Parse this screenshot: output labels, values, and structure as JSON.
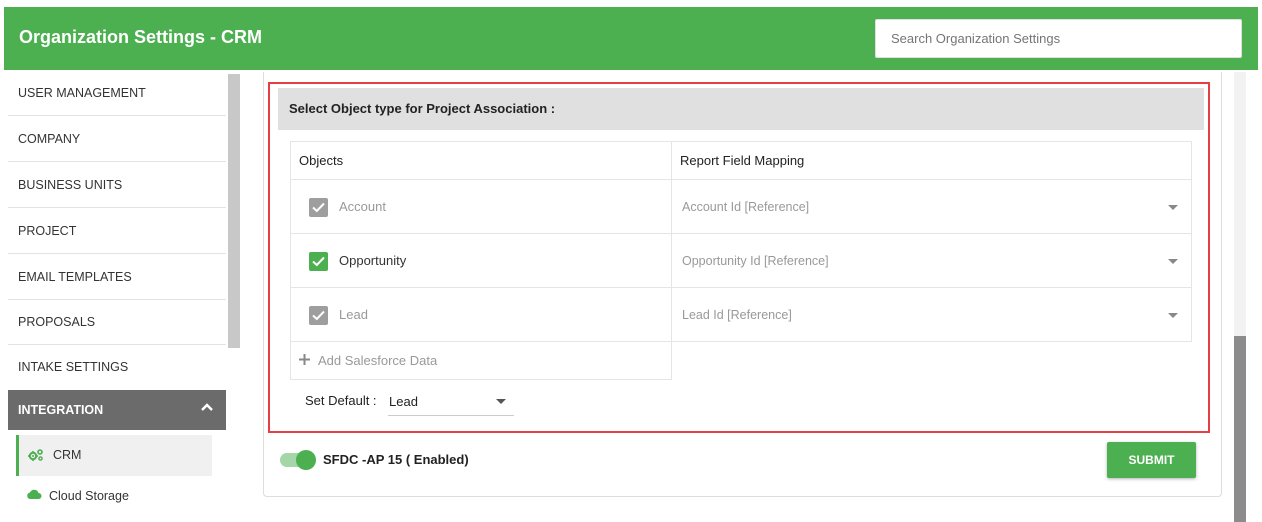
{
  "header": {
    "title": "Organization Settings - CRM",
    "search_placeholder": "Search Organization Settings"
  },
  "sidebar": {
    "items": [
      {
        "label": "USER MANAGEMENT"
      },
      {
        "label": "COMPANY"
      },
      {
        "label": "BUSINESS UNITS"
      },
      {
        "label": "PROJECT"
      },
      {
        "label": "EMAIL TEMPLATES"
      },
      {
        "label": "PROPOSALS"
      },
      {
        "label": "INTAKE SETTINGS"
      }
    ],
    "integration": {
      "label": "INTEGRATION",
      "expanded": true,
      "children": [
        {
          "label": "CRM",
          "icon": "gears-icon",
          "active": true
        },
        {
          "label": "Cloud Storage",
          "icon": "cloud-icon",
          "active": false
        }
      ]
    }
  },
  "association": {
    "heading": "Select Object type for Project Association :",
    "col_objects": "Objects",
    "col_mapping": "Report Field Mapping",
    "rows": [
      {
        "object": "Account",
        "checked": true,
        "disabled": true,
        "mapping": "Account Id [Reference]"
      },
      {
        "object": "Opportunity",
        "checked": true,
        "disabled": false,
        "mapping": "Opportunity Id [Reference]"
      },
      {
        "object": "Lead",
        "checked": true,
        "disabled": true,
        "mapping": "Lead Id [Reference]"
      }
    ],
    "add_link": "Add Salesforce Data",
    "default_label": "Set Default :",
    "default_value": "Lead"
  },
  "footer": {
    "toggle_label": "SFDC -AP 15 ( Enabled)",
    "toggle_on": true,
    "submit_label": "SUBMIT"
  },
  "colors": {
    "primary": "#4caf50",
    "highlight_border": "#e33f45",
    "disabled_check": "#9e9e9e"
  }
}
